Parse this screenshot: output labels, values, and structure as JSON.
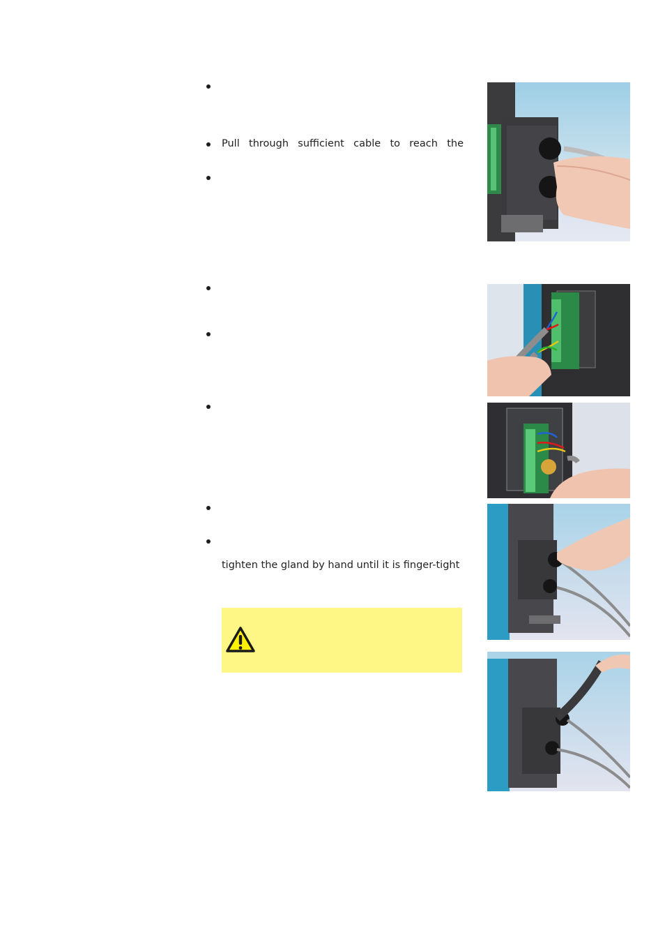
{
  "page": {
    "bullets": [
      {
        "id": 1,
        "text": ""
      },
      {
        "id": 2,
        "text": "Pull through sufficient cable to reach the"
      },
      {
        "id": 3,
        "text": ""
      },
      {
        "id": 4,
        "text": ""
      },
      {
        "id": 5,
        "text": ""
      },
      {
        "id": 6,
        "text": ""
      },
      {
        "id": 7,
        "text": ""
      },
      {
        "id": 8,
        "text": ""
      }
    ],
    "continuation_text": "tighten the gland by hand until it is finger-tight",
    "warning": {
      "icon": "warning-triangle-icon",
      "text": "",
      "background": "#fef785"
    },
    "photos": [
      {
        "id": "photo-1",
        "subject": "Hand pushing cable through gland into terminal box on pump"
      },
      {
        "id": "photo-2",
        "subject": "Hand connecting wires to green terminal block on circuit board"
      },
      {
        "id": "photo-3",
        "subject": "Hand attaching coloured wires with ferrite ring to terminal block"
      },
      {
        "id": "photo-4",
        "subject": "Hand tightening cable gland by hand on pump terminal box"
      },
      {
        "id": "photo-5",
        "subject": "Wrench tightening cable gland on pump terminal box"
      }
    ]
  }
}
